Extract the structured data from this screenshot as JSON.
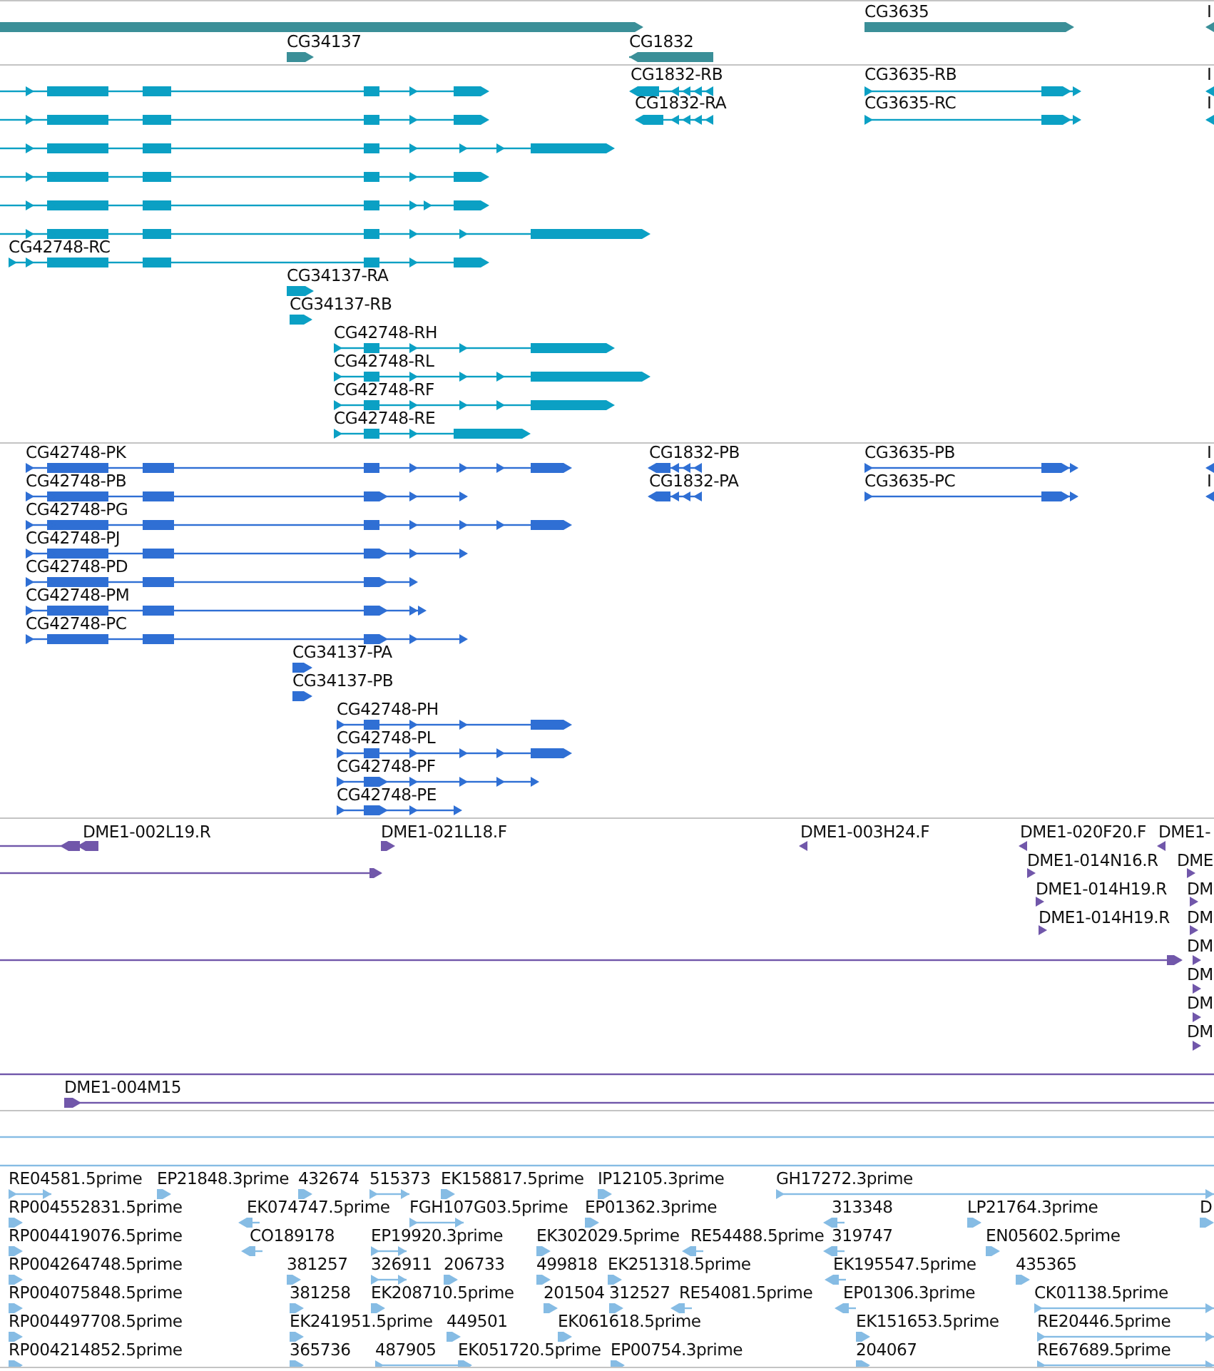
{
  "tracks": [
    {
      "kind": "gene",
      "features": [
        {
          "reverse": false
        },
        {
          "label": "CG34137",
          "reverse": false
        },
        {
          "label": "CG1832",
          "reverse": true
        },
        {
          "label": "CG3635",
          "reverse": false
        },
        {
          "label": "I",
          "reverse": true
        }
      ]
    },
    {
      "kind": "transcript",
      "features": [
        {
          "reverse": false
        },
        {
          "reverse": false
        },
        {
          "reverse": false
        },
        {
          "reverse": false
        },
        {
          "reverse": false
        },
        {
          "reverse": false
        },
        {
          "label": "CG42748-RC",
          "reverse": false
        },
        {
          "label": "CG34137-RA",
          "reverse": false
        },
        {
          "label": "CG34137-RB",
          "reverse": false
        },
        {
          "label": "CG42748-RH",
          "reverse": false
        },
        {
          "label": "CG42748-RL",
          "reverse": false
        },
        {
          "label": "CG42748-RF",
          "reverse": false
        },
        {
          "label": "CG42748-RE",
          "reverse": false
        },
        {
          "label": "CG1832-RB",
          "reverse": true
        },
        {
          "label": "CG1832-RA",
          "reverse": true
        },
        {
          "label": "CG3635-RB",
          "reverse": false
        },
        {
          "label": "CG3635-RC",
          "reverse": false
        },
        {
          "label": "I",
          "reverse": true
        },
        {
          "label": "I",
          "reverse": true
        }
      ]
    },
    {
      "kind": "protein",
      "features": [
        {
          "label": "CG42748-PK",
          "reverse": false
        },
        {
          "label": "CG42748-PB",
          "reverse": false
        },
        {
          "label": "CG42748-PG",
          "reverse": false
        },
        {
          "label": "CG42748-PJ",
          "reverse": false
        },
        {
          "label": "CG42748-PD",
          "reverse": false
        },
        {
          "label": "CG42748-PM",
          "reverse": false
        },
        {
          "label": "CG42748-PC",
          "reverse": false
        },
        {
          "label": "CG34137-PA",
          "reverse": false
        },
        {
          "label": "CG34137-PB",
          "reverse": false
        },
        {
          "label": "CG42748-PH",
          "reverse": false
        },
        {
          "label": "CG42748-PL",
          "reverse": false
        },
        {
          "label": "CG42748-PF",
          "reverse": false
        },
        {
          "label": "CG42748-PE",
          "reverse": false
        },
        {
          "label": "CG1832-PB",
          "reverse": true
        },
        {
          "label": "CG1832-PA",
          "reverse": true
        },
        {
          "label": "CG3635-PB",
          "reverse": false
        },
        {
          "label": "CG3635-PC",
          "reverse": false
        },
        {
          "label": "I",
          "reverse": true
        },
        {
          "label": "I",
          "reverse": true
        }
      ]
    },
    {
      "kind": "clone",
      "features": [
        {
          "reverse": true
        },
        {
          "label": "DME1-002L19.R",
          "reverse": true
        },
        {
          "label": "DME1-021L18.F",
          "reverse": false
        },
        {
          "reverse": false
        },
        {
          "label": "DME1-003H24.F",
          "reverse": true
        },
        {
          "label": "DME1-020F20.F",
          "reverse": true
        },
        {
          "label": "DME1-",
          "reverse": true
        },
        {
          "label": "DME1-014N16.R",
          "reverse": false
        },
        {
          "label": "DME",
          "reverse": false
        },
        {
          "label": "DME1-014H19.R",
          "reverse": false
        },
        {
          "label": "DM",
          "reverse": false
        },
        {
          "label": "DME1-014H19.R",
          "reverse": false
        },
        {
          "label": "DM",
          "reverse": false
        },
        {
          "reverse": false
        },
        {
          "label": "DM",
          "reverse": false
        },
        {
          "label": "DM",
          "reverse": false
        },
        {
          "label": "DM",
          "reverse": false
        },
        {
          "label": "DM",
          "reverse": false
        },
        {
          "label": "DME1-004M15",
          "reverse": false
        }
      ]
    },
    {
      "kind": "est",
      "features": [
        {
          "label": "RE04581.5prime",
          "reverse": false
        },
        {
          "label": "EP21848.3prime",
          "reverse": false
        },
        {
          "label": "432674",
          "reverse": false
        },
        {
          "label": "515373",
          "reverse": false
        },
        {
          "label": "EK158817.5prime",
          "reverse": false
        },
        {
          "label": "IP12105.3prime",
          "reverse": false
        },
        {
          "label": "GH17272.3prime",
          "reverse": false
        },
        {
          "label": "RP004552831.5prime",
          "reverse": false
        },
        {
          "label": "EK074747.5prime",
          "reverse": true
        },
        {
          "label": "FGH107G03.5prime",
          "reverse": false
        },
        {
          "label": "EP01362.3prime",
          "reverse": false
        },
        {
          "label": "313348",
          "reverse": true
        },
        {
          "label": "LP21764.3prime",
          "reverse": false
        },
        {
          "label": "D",
          "reverse": false
        },
        {
          "label": "RP004419076.5prime",
          "reverse": false
        },
        {
          "label": "CO189178",
          "reverse": true
        },
        {
          "label": "EP19920.3prime",
          "reverse": false
        },
        {
          "label": "EK302029.5prime",
          "reverse": false
        },
        {
          "label": "RE54488.5prime",
          "reverse": true
        },
        {
          "label": "319747",
          "reverse": true
        },
        {
          "label": "EN05602.5prime",
          "reverse": false
        },
        {
          "label": "RP004264748.5prime",
          "reverse": false
        },
        {
          "label": "381257",
          "reverse": false
        },
        {
          "label": "326911",
          "reverse": false
        },
        {
          "label": "206733",
          "reverse": false
        },
        {
          "label": "499818",
          "reverse": false
        },
        {
          "label": "EK251318.5prime",
          "reverse": false
        },
        {
          "label": "EK195547.5prime",
          "reverse": true
        },
        {
          "label": "435365",
          "reverse": false
        },
        {
          "label": "RP004075848.5prime",
          "reverse": false
        },
        {
          "label": "381258",
          "reverse": false
        },
        {
          "label": "EK208710.5prime",
          "reverse": false
        },
        {
          "label": "201504",
          "reverse": false
        },
        {
          "label": "312527",
          "reverse": false
        },
        {
          "label": "RE54081.5prime",
          "reverse": true
        },
        {
          "label": "EP01306.3prime",
          "reverse": true
        },
        {
          "label": "CK01138.5prime",
          "reverse": false
        },
        {
          "label": "RP004497708.5prime",
          "reverse": false
        },
        {
          "label": "EK241951.5prime",
          "reverse": false
        },
        {
          "label": "449501",
          "reverse": false
        },
        {
          "label": "EK061618.5prime",
          "reverse": false
        },
        {
          "label": "EK151653.5prime",
          "reverse": false
        },
        {
          "label": "RE20446.5prime",
          "reverse": false
        },
        {
          "label": "RP004214852.5prime",
          "reverse": false
        },
        {
          "label": "365736",
          "reverse": false
        },
        {
          "label": "487905",
          "reverse": false
        },
        {
          "label": "EK051720.5prime",
          "reverse": false
        },
        {
          "label": "EP00754.3prime",
          "reverse": false
        },
        {
          "label": "204067",
          "reverse": false
        },
        {
          "label": "RE67689.5prime",
          "reverse": false
        }
      ]
    }
  ]
}
